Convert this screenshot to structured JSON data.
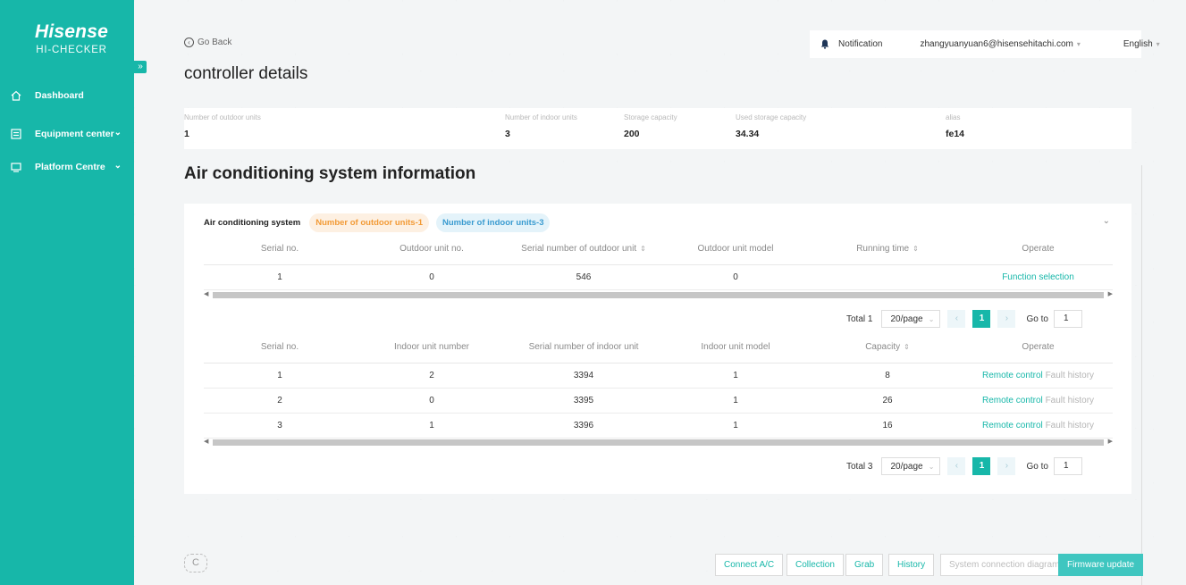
{
  "brand": {
    "name": "Hisense",
    "product": "HI-CHECKER"
  },
  "sidebar": {
    "items": [
      {
        "label": "Dashboard",
        "icon": "home-icon"
      },
      {
        "label": "Equipment center",
        "icon": "list-icon",
        "expand": "⌄"
      },
      {
        "label": "Platform Centre",
        "icon": "monitor-icon",
        "expand": "⌄"
      }
    ],
    "collapse_glyph": "»"
  },
  "header": {
    "back_label": "Go Back",
    "title": "controller details",
    "notification_label": "Notification",
    "user_email": "zhangyuanyuan6@hisensehitachi.com",
    "language": "English"
  },
  "info": {
    "fields": [
      {
        "label": "Number of outdoor units",
        "value": "1"
      },
      {
        "label": "Number of indoor units",
        "value": "3"
      },
      {
        "label": "Storage capacity",
        "value": "200"
      },
      {
        "label": "Used storage capacity",
        "value": "34.34"
      },
      {
        "label": "alias",
        "value": "fe14"
      }
    ]
  },
  "section_title": "Air conditioning system information",
  "system": {
    "tab_label": "Air conditioning system",
    "outdoor_pill": "Number of outdoor units-1",
    "indoor_pill": "Number of indoor units-3"
  },
  "outdoor_table": {
    "headers": [
      "Serial no.",
      "Outdoor unit no.",
      "Serial number of outdoor unit",
      "Outdoor unit model",
      "Running time",
      "Operate"
    ],
    "rows": [
      {
        "serial": "1",
        "unit_no": "0",
        "serial_number": "546",
        "model": "0",
        "running_time": "",
        "action": "Function selection"
      }
    ],
    "pager": {
      "total": "Total 1",
      "page_size": "20/page",
      "page": "1",
      "goto_label": "Go to",
      "goto_value": "1"
    }
  },
  "indoor_table": {
    "headers": [
      "Serial no.",
      "Indoor unit number",
      "Serial number of indoor unit",
      "Indoor unit model",
      "Capacity",
      "Operate"
    ],
    "rows": [
      {
        "serial": "1",
        "unit_no": "2",
        "serial_number": "3394",
        "model": "1",
        "capacity": "8",
        "action1": "Remote control",
        "action2": "Fault history"
      },
      {
        "serial": "2",
        "unit_no": "0",
        "serial_number": "3395",
        "model": "1",
        "capacity": "26",
        "action1": "Remote control",
        "action2": "Fault history"
      },
      {
        "serial": "3",
        "unit_no": "1",
        "serial_number": "3396",
        "model": "1",
        "capacity": "16",
        "action1": "Remote control",
        "action2": "Fault history"
      }
    ],
    "pager": {
      "total": "Total 3",
      "page_size": "20/page",
      "page": "1",
      "goto_label": "Go to",
      "goto_value": "1"
    }
  },
  "footer": {
    "refresh_glyph": "C",
    "buttons": [
      "Connect A/C",
      "Collection",
      "Grab",
      "History",
      "System connection diagram",
      "Firmware update"
    ]
  },
  "colors": {
    "accent": "#17b7a9",
    "orange": "#f29a36",
    "blue": "#3a9bd0",
    "primary_button": "#3fc6c0"
  }
}
